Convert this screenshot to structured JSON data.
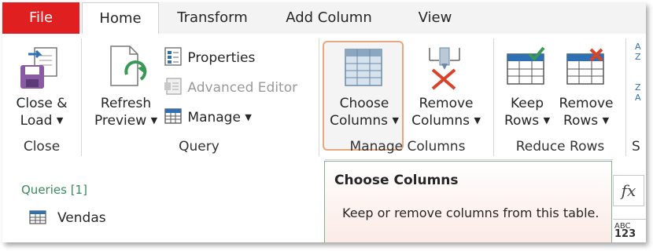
{
  "tabs": [
    "File",
    "Home",
    "Transform",
    "Add Column",
    "View"
  ],
  "ribbon": {
    "close_load": {
      "line1": "Close &",
      "line2": "Load",
      "group": "Close"
    },
    "refresh_preview": {
      "line1": "Refresh",
      "line2": "Preview"
    },
    "properties": "Properties",
    "advanced_editor": "Advanced Editor",
    "manage": "Manage",
    "query_group": "Query",
    "choose_columns": {
      "line1": "Choose",
      "line2": "Columns"
    },
    "remove_columns": {
      "line1": "Remove",
      "line2": "Columns"
    },
    "manage_columns_group": "Manage Columns",
    "keep_rows": {
      "line1": "Keep",
      "line2": "Rows"
    },
    "remove_rows": {
      "line1": "Remove",
      "line2": "Rows"
    },
    "reduce_rows_group": "Reduce Rows",
    "partial_group": "S"
  },
  "queries": {
    "header": "Queries [1]",
    "items": [
      "Vendas"
    ]
  },
  "tooltip": {
    "title": "Choose Columns",
    "body": "Keep or remove columns from this table."
  },
  "formula_icon": "fx",
  "colors": {
    "file_tab": "#e02020",
    "accent_green": "#3a8a5c",
    "highlight_border": "#e8a77d"
  }
}
